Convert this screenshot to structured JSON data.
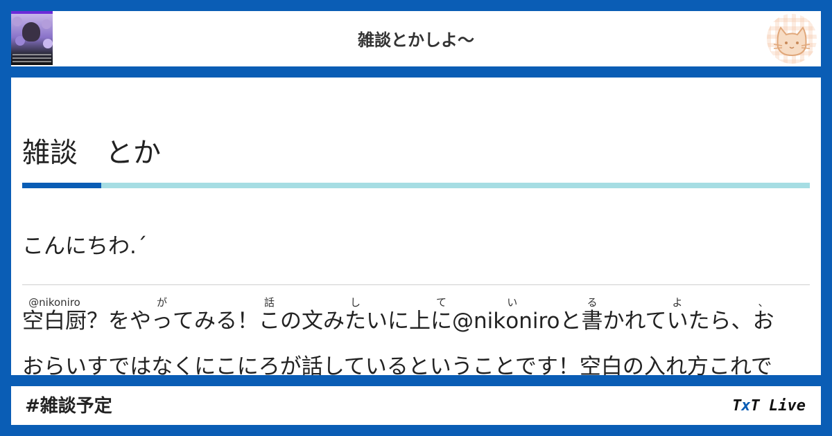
{
  "header": {
    "title": "雑談とかしよ〜",
    "avatar_icon": "user-avatar",
    "logo_icon": "cat-face-icon"
  },
  "post": {
    "title": "雑談　とか",
    "greeting": "こんにちわ.ˊ",
    "body_line1": [
      {
        "text": "空白厨",
        "ruby": "@nikoniro"
      },
      {
        "text": "？をや",
        "ruby": ""
      },
      {
        "text": "っ",
        "ruby": "が"
      },
      {
        "text": "てみる！",
        "ruby": ""
      },
      {
        "text": "こ",
        "ruby": "話"
      },
      {
        "text": "の文み",
        "ruby": ""
      },
      {
        "text": "た",
        "ruby": "し"
      },
      {
        "text": "いに上",
        "ruby": ""
      },
      {
        "text": "に",
        "ruby": "て"
      },
      {
        "text": "@nik",
        "ruby": ""
      },
      {
        "text": "o",
        "ruby": "い"
      },
      {
        "text": "niroと",
        "ruby": ""
      },
      {
        "text": "書",
        "ruby": "る"
      },
      {
        "text": "かれて",
        "ruby": ""
      },
      {
        "text": "い",
        "ruby": "よ"
      },
      {
        "text": "たら、",
        "ruby": ""
      },
      {
        "text": "お",
        "ruby": "、"
      }
    ],
    "body_line2": "おらいすではなくにこにろが話しているということです！空白の入れ方これで"
  },
  "footer": {
    "hashtag": "#雑談予定",
    "brand_pre": "T",
    "brand_x": "x",
    "brand_post": "T Live"
  },
  "colors": {
    "frame": "#0a5db5",
    "title_bar": "#a6dde3",
    "title_bar_accent": "#0a5db5"
  }
}
